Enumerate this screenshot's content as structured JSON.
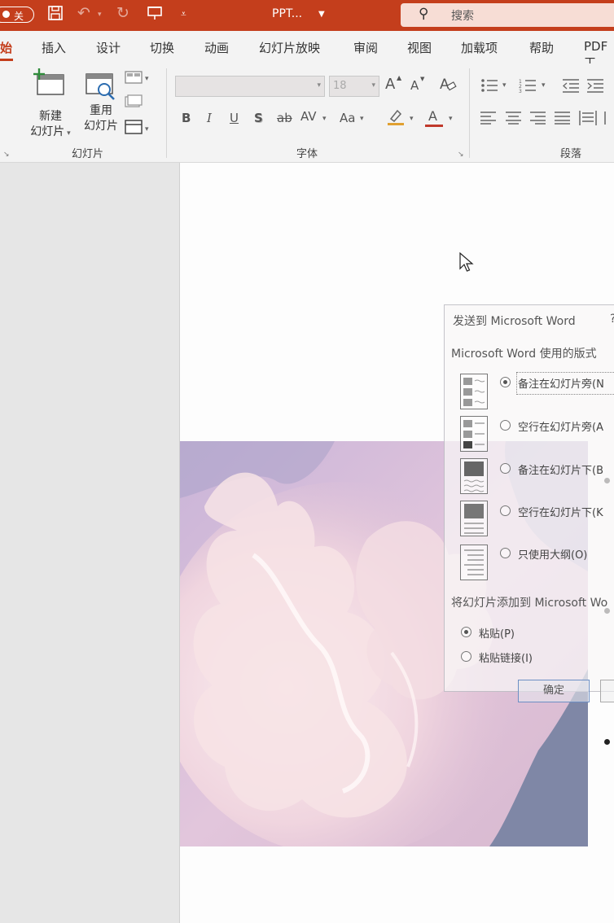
{
  "titlebar": {
    "autosave_label": "关",
    "title": "PPT...",
    "search_placeholder": "搜索",
    "colors": {
      "accent": "#c43e1c"
    }
  },
  "tabs": [
    {
      "label": "始",
      "active": true
    },
    {
      "label": "插入"
    },
    {
      "label": "设计"
    },
    {
      "label": "切换"
    },
    {
      "label": "动画"
    },
    {
      "label": "幻灯片放映"
    },
    {
      "label": "审阅"
    },
    {
      "label": "视图"
    },
    {
      "label": "加载项"
    },
    {
      "label": "帮助"
    },
    {
      "label": "PDF工"
    }
  ],
  "ribbon": {
    "slides_group": {
      "new_slide_line1": "新建",
      "new_slide_line2": "幻灯片",
      "reuse_line1": "重用",
      "reuse_line2": "幻灯片",
      "label": "幻灯片"
    },
    "font_group": {
      "font_size": "18",
      "grow_font": "A",
      "shrink_font": "A",
      "bold": "B",
      "italic": "I",
      "underline": "U",
      "shadow": "S",
      "strike": "ab",
      "spacing": "AV",
      "change_case": "Aa",
      "font_color": "A",
      "label": "字体"
    },
    "paragraph_group": {
      "label": "段落"
    }
  },
  "dialog": {
    "title": "发送到 Microsoft Word",
    "help": "?",
    "layout_heading": "Microsoft Word 使用的版式",
    "layout_options": [
      {
        "label": "备注在幻灯片旁(N",
        "checked": true
      },
      {
        "label": "空行在幻灯片旁(A",
        "checked": false
      },
      {
        "label": "备注在幻灯片下(B",
        "checked": false
      },
      {
        "label": "空行在幻灯片下(K",
        "checked": false
      },
      {
        "label": "只使用大纲(O)",
        "checked": false
      }
    ],
    "add_heading": "将幻灯片添加到 Microsoft Wo",
    "add_options": [
      {
        "label": "粘贴(P)",
        "checked": true
      },
      {
        "label": "粘贴链接(I)",
        "checked": false
      }
    ],
    "ok_label": "确定"
  }
}
